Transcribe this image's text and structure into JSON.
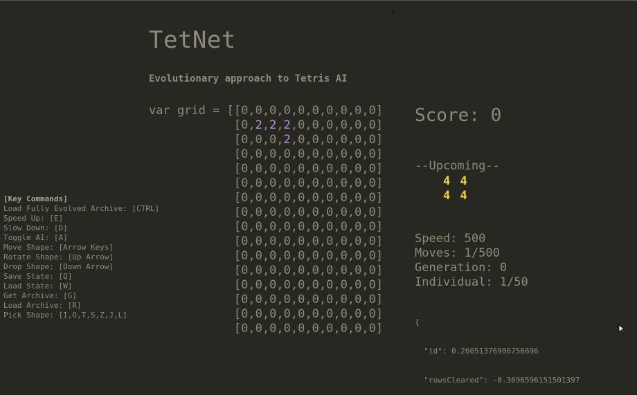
{
  "cursor_char": "e",
  "title": "TetNet",
  "subtitle": "Evolutionary approach to Tetris AI",
  "grid": {
    "prefix": "var grid = [",
    "rows": [
      "[0,0,0,0,0,0,0,0,0,0]",
      "[0,2,2,2,0,0,0,0,0,0]",
      "[0,0,0,2,0,0,0,0,0,0]",
      "[0,0,0,0,0,0,0,0,0,0]",
      "[0,0,0,0,0,0,0,0,0,0]",
      "[0,0,0,0,0,0,0,0,0,0]",
      "[0,0,0,0,0,0,0,0,0,0]",
      "[0,0,0,0,0,0,0,0,0,0]",
      "[0,0,0,0,0,0,0,0,0,0]",
      "[0,0,0,0,0,0,0,0,0,0]",
      "[0,0,0,0,0,0,0,0,0,0]",
      "[0,0,0,0,0,0,0,0,0,0]",
      "[0,0,0,0,0,0,0,0,0,0]",
      "[0,0,0,0,0,0,0,0,0,0]",
      "[0,0,0,0,0,0,0,0,0,0]",
      "[0,0,0,0,0,0,0,0,0,0]"
    ]
  },
  "score_text": "Score: 0",
  "upcoming": {
    "label": "--Upcoming--",
    "rows": [
      "4 4",
      "4 4"
    ]
  },
  "stats": {
    "speed": "Speed: 500",
    "moves": "Moves: 1/500",
    "generation": "Generation: 0",
    "individual": "Individual: 1/50"
  },
  "key_commands": {
    "heading": "[Key Commands]",
    "items": [
      "Load Fully Evolved Archive: [CTRL]",
      "Speed Up: [E]",
      "Slow Down: [D]",
      "Toggle AI: [A]",
      "Move Shape: [Arrow Keys]",
      "Rotate Shape: [Up Arrow]",
      "Drop Shape: [Down Arrow]",
      "Save State: [Q]",
      "Load State: [W]",
      "Get Archive: [G]",
      "Load Archive: [R]",
      "Pick Shape: [I,O,T,S,Z,J,L]"
    ]
  },
  "genome_json": {
    "open": "{",
    "id_line": "  \"id\": 0.26051376906756696",
    "rows_cleared_line": "  \"rowsCleared\": -0.3696596151501397"
  },
  "colors": {
    "background": "#272822",
    "text": "#8f8a78",
    "active_cell": "#c28ee0",
    "upcoming_piece": "#e8d344"
  }
}
